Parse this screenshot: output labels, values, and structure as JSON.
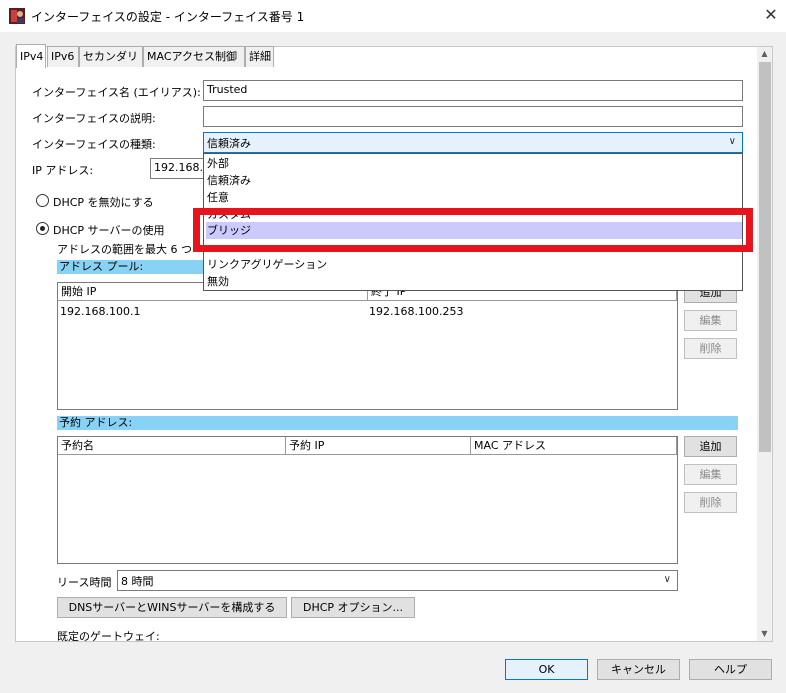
{
  "window": {
    "title": "インターフェイスの設定 - インターフェイス番号 1",
    "close_glyph": "✕"
  },
  "tabs": [
    {
      "label": "IPv4"
    },
    {
      "label": "IPv6"
    },
    {
      "label": "セカンダリ"
    },
    {
      "label": "MACアクセス制御"
    },
    {
      "label": "詳細"
    }
  ],
  "form": {
    "name_label": "インターフェイス名 (エイリアス):",
    "name_value": "Trusted",
    "desc_label": "インターフェイスの説明:",
    "desc_value": "",
    "type_label": "インターフェイスの種類:",
    "type_value": "信頼済み",
    "ip_label": "IP アドレス:",
    "ip_value": "192.168.1"
  },
  "dhcp": {
    "disable_label": "DHCP を無効にする",
    "server_label": "DHCP サーバーの使用",
    "range_note": "アドレスの範囲を最大 6 つ"
  },
  "address_pool": {
    "header": "アドレス プール:",
    "col_start": "開始 IP",
    "col_end": "終了 IP",
    "rows": [
      {
        "start": "192.168.100.1",
        "end": "192.168.100.253"
      }
    ],
    "add": "追加",
    "edit": "編集",
    "delete": "削除"
  },
  "reserved": {
    "header": "予約 アドレス:",
    "col_name": "予約名",
    "col_ip": "予約 IP",
    "col_mac": "MAC アドレス",
    "add": "追加",
    "edit": "編集",
    "delete": "削除"
  },
  "lease": {
    "label": "リース時間",
    "value": "8 時間"
  },
  "buttons": {
    "dns_wins": "DNSサーバーとWINSサーバーを構成する",
    "dhcp_options": "DHCP オプション...",
    "ok": "OK",
    "cancel": "キャンセル",
    "help": "ヘルプ"
  },
  "gateway_label": "既定のゲートウェイ:",
  "dropdown_options": [
    {
      "label": "外部",
      "selected": false
    },
    {
      "label": "信頼済み",
      "selected": false
    },
    {
      "label": "任意",
      "selected": false
    },
    {
      "label": "カスタム",
      "selected": false
    },
    {
      "label": "ブリッジ",
      "selected": true
    },
    {
      "label": "",
      "selected": false
    },
    {
      "label": "リンクアグリゲーション",
      "selected": false
    },
    {
      "label": "無効",
      "selected": false
    }
  ],
  "colors": {
    "highlight": "#e8141d",
    "selected_option": "#cccafc",
    "band": "#88d3f5"
  }
}
